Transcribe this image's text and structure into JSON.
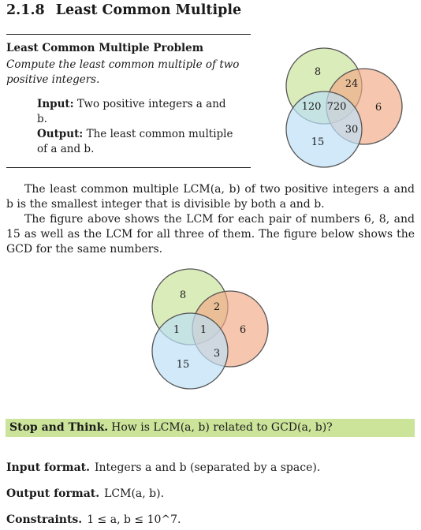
{
  "section": {
    "number": "2.1.8",
    "title": "Least Common Multiple"
  },
  "problem": {
    "title": "Least Common Multiple Problem",
    "description": "Compute the least common multiple of two positive integers.",
    "input_label": "Input:",
    "input_text": "Two positive integers a and b.",
    "output_label": "Output:",
    "output_text": "The least common multiple of a and b."
  },
  "paragraphs": [
    "The least common multiple LCM(a, b) of two positive integers a and b is the smallest integer that is divisible by both a and b.",
    "The figure above shows the LCM for each pair of numbers 6, 8, and 15 as well as the LCM for all three of them. The figure below shows the GCD for the same numbers."
  ],
  "venn_lcm": {
    "circle_a": "8",
    "circle_b": "6",
    "circle_c": "15",
    "ab": "24",
    "ac": "120",
    "bc": "30",
    "abc": "720"
  },
  "venn_gcd": {
    "circle_a": "8",
    "circle_b": "6",
    "circle_c": "15",
    "ab": "2",
    "ac": "1",
    "bc": "3",
    "abc": "1"
  },
  "colors": {
    "circle_a": "#cfe6a4",
    "circle_b": "#f2a884",
    "circle_c": "#bde0f6",
    "stop_bg": "#cce49a"
  },
  "stop_and_think": {
    "label": "Stop and Think.",
    "text": "How is LCM(a, b) related to GCD(a, b)?"
  },
  "formats": {
    "input_label": "Input format.",
    "input_text": "Integers a and b (separated by a space).",
    "output_label": "Output format.",
    "output_text": "LCM(a, b).",
    "constraints_label": "Constraints.",
    "constraints_text": "1 ≤ a, b ≤ 10^7."
  }
}
